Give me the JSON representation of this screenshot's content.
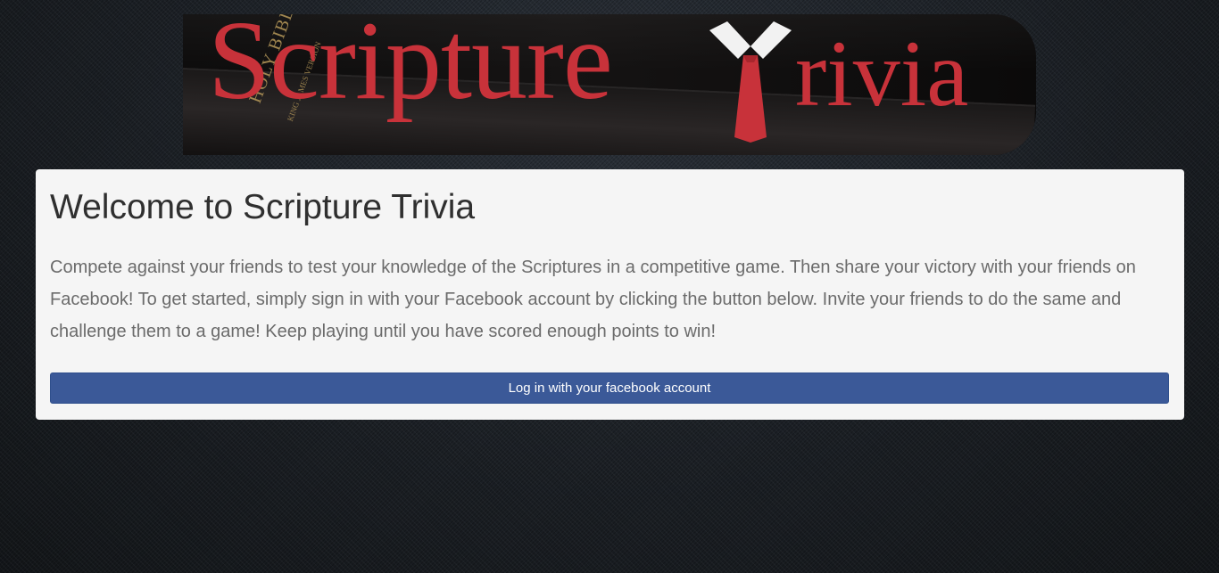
{
  "header": {
    "logo_alt": "Scripture Trivia",
    "logo_word_left": "Scripture",
    "logo_word_right": "rivia",
    "logo_icon": "necktie-icon",
    "book_spine_title": "HOLY BIBLE",
    "book_spine_subtitle": "KING JAMES VERSION"
  },
  "welcome": {
    "title": "Welcome to Scripture Trivia",
    "body": "Compete against your friends to test your knowledge of the Scriptures in a competitive game. Then share your victory with your friends on Facebook! To get started, simply sign in with your Facebook account by clicking the button below. Invite your friends to do the same and challenge them to a game! Keep playing until you have scored enough points to win!",
    "login_button_label": "Log in with your facebook account"
  },
  "colors": {
    "logo_red": "#c8323a",
    "facebook_blue": "#3b5998",
    "panel_background": "#f5f5f5",
    "page_background": "#1b1f24"
  }
}
